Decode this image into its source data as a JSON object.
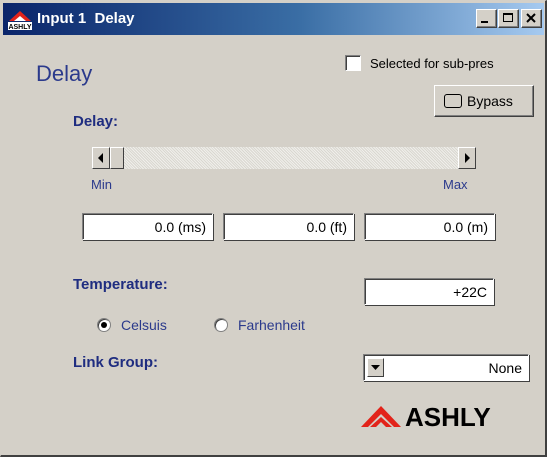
{
  "window": {
    "title": "Input 1  Delay",
    "logo_icon": "ashly-logo-icon",
    "controls": [
      "minimize-icon",
      "maximize-icon",
      "close-icon"
    ]
  },
  "panel": {
    "heading": "Delay",
    "sub_preset_checkbox": {
      "label": "Selected for sub-pres",
      "checked": false
    },
    "bypass_button": {
      "label": "Bypass",
      "active": false
    }
  },
  "delay": {
    "label": "Delay:",
    "slider": {
      "min_label": "Min",
      "max_label": "Max",
      "level": 0
    },
    "values": {
      "ms": "0.0 (ms)",
      "ft": "0.0 (ft)",
      "m": "0.0 (m)"
    }
  },
  "temperature": {
    "label": "Temperature:",
    "value": "+22C",
    "units": [
      {
        "label": "Celsuis",
        "selected": true
      },
      {
        "label": "Farhenheit",
        "selected": false
      }
    ]
  },
  "link_group": {
    "label": "Link Group:",
    "value": "None"
  },
  "brand": {
    "name": "ASHLY",
    "accent_color": "#e2231a"
  },
  "colors": {
    "titlebar_start": "#0a246a",
    "titlebar_end": "#a6caf0",
    "label_blue": "#1f2d80"
  }
}
